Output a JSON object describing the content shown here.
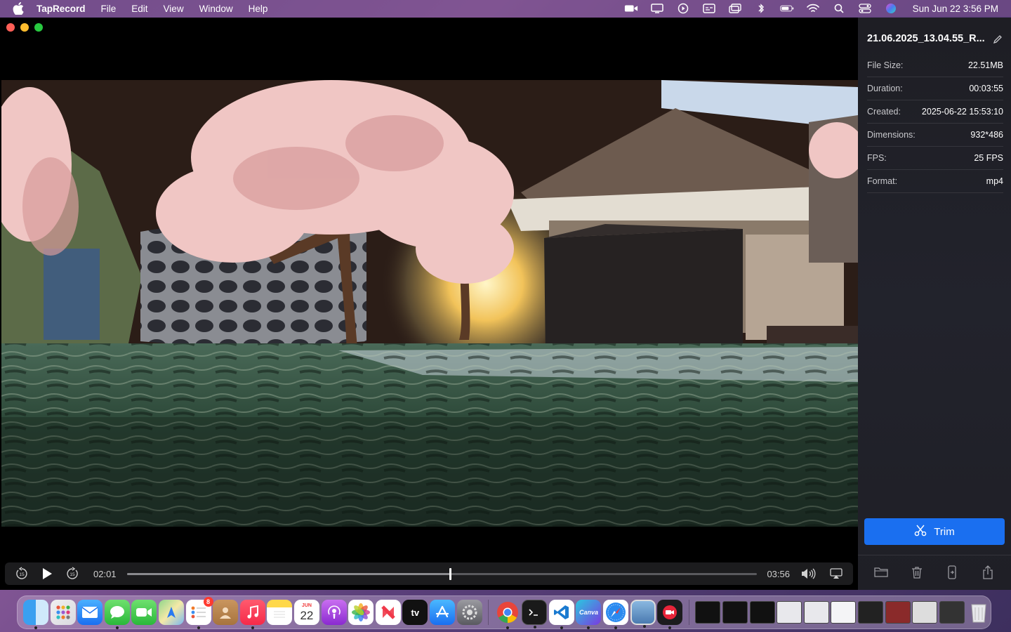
{
  "menubar": {
    "app_name": "TapRecord",
    "menus": [
      "File",
      "Edit",
      "View",
      "Window",
      "Help"
    ],
    "clock": "Sun Jun 22  3:56 PM"
  },
  "player": {
    "current_time": "02:01",
    "total_time": "03:56",
    "progress": 0.513,
    "skip_back_seconds": "15",
    "skip_forward_seconds": "15"
  },
  "details": {
    "file_name": "21.06.2025_13.04.55_R...",
    "rows": [
      {
        "label": "File Size:",
        "value": "22.51MB"
      },
      {
        "label": "Duration:",
        "value": "00:03:55"
      },
      {
        "label": "Created:",
        "value": "2025-06-22 15:53:10"
      },
      {
        "label": "Dimensions:",
        "value": "932*486"
      },
      {
        "label": "FPS:",
        "value": "25 FPS"
      },
      {
        "label": "Format:",
        "value": "mp4"
      }
    ],
    "trim_label": "Trim"
  },
  "dock": {
    "calendar_month": "JUN",
    "calendar_day": "22",
    "reminders_badge": "8",
    "appletv_label": "tv",
    "canva_label": "Canva"
  },
  "colors": {
    "accent": "#1a6ff0",
    "panel_bg": "#1e1e24",
    "controls_bg": "#1c1c1e"
  }
}
